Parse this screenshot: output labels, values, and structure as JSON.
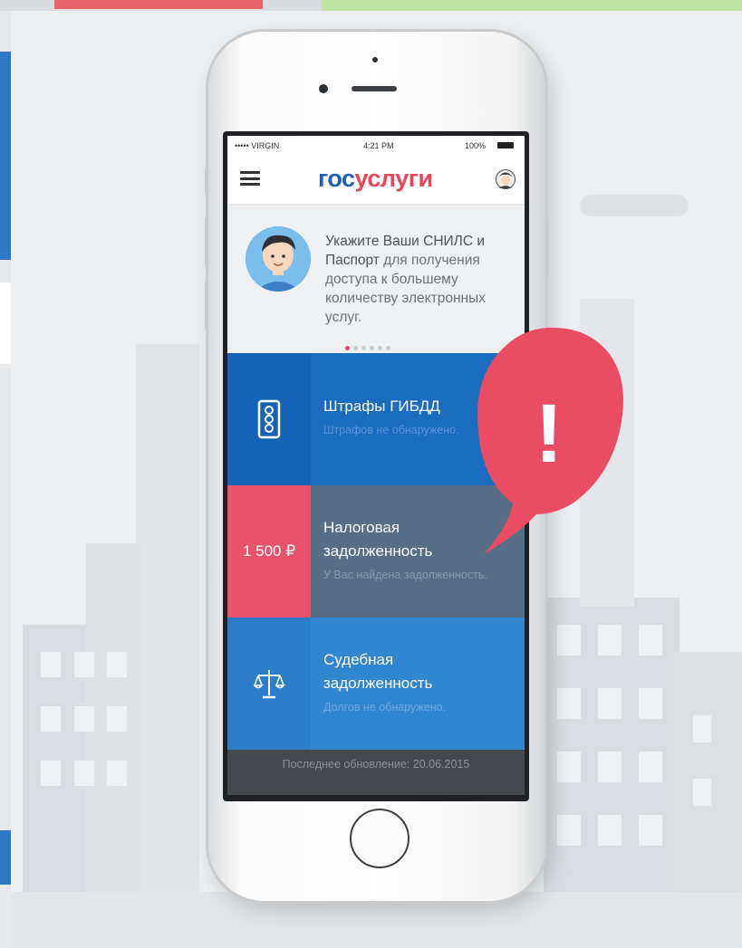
{
  "status_bar": {
    "carrier": "••••• VIRGIN",
    "time": "4:21 PM",
    "battery": "100%"
  },
  "header": {
    "logo_part1": "гос",
    "logo_part2": "услуги",
    "menu_icon": "hamburger-menu-icon",
    "profile_icon": "user-avatar-icon"
  },
  "banner": {
    "text_lead": "Укажите Ваши СНИЛС и Паспорт",
    "text_rest": " для получения доступа к большему количеству электронных услуг.",
    "pagination_total": 6,
    "pagination_active": 1
  },
  "cards": [
    {
      "icon": "traffic-light-icon",
      "title": "Штрафы ГИБДД",
      "subtitle": "Штрафов не обнаружено."
    },
    {
      "amount": "1 500 ₽",
      "title_line1": "Налоговая",
      "title_line2": "задолженность",
      "subtitle": "У Вас найдена задолженность."
    },
    {
      "icon": "scales-of-justice-icon",
      "title_line1": "Судебная",
      "title_line2": "задолженность",
      "subtitle": "Долгов не обнаружено."
    }
  ],
  "footer": {
    "text": "Последнее обновление: 20.06.2015"
  },
  "alert": {
    "symbol": "!",
    "icon": "exclamation-alert-icon"
  },
  "colors": {
    "brand_blue": "#1f5fb0",
    "brand_red": "#e8445a",
    "card_blue": "#1a6cc0",
    "card_slate": "#566f86",
    "card_light_blue": "#3186d0",
    "alert_red": "#ea4c63"
  }
}
